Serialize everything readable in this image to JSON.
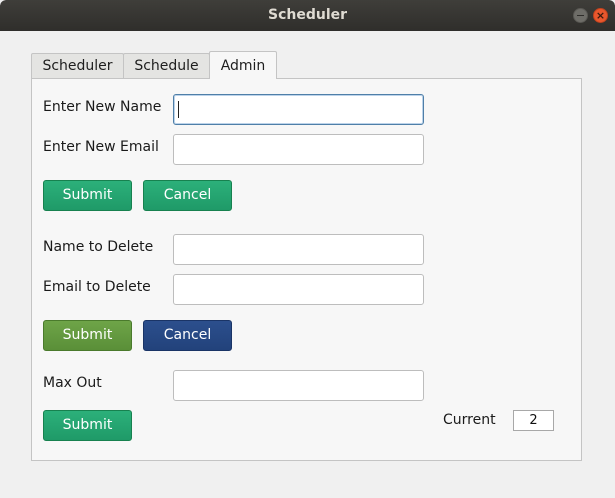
{
  "window": {
    "title": "Scheduler",
    "close_glyph": "×"
  },
  "tabs": [
    {
      "label": "Scheduler",
      "active": false
    },
    {
      "label": "Schedule",
      "active": false
    },
    {
      "label": "Admin",
      "active": true
    }
  ],
  "add_section": {
    "name_label": "Enter New Name",
    "name_value": "",
    "email_label": "Enter New Email",
    "email_value": "",
    "submit_label": "Submit",
    "cancel_label": "Cancel"
  },
  "delete_section": {
    "name_label": "Name to Delete",
    "name_value": "",
    "email_label": "Email to Delete",
    "email_value": "",
    "submit_label": "Submit",
    "cancel_label": "Cancel"
  },
  "max_section": {
    "label": "Max Out",
    "value": "",
    "submit_label": "Submit",
    "current_label": "Current",
    "current_value": "2"
  },
  "colors": {
    "submit_green": "#1f9a68",
    "cancel_green": "#1f9a68",
    "submit_olive": "#5a8f38",
    "cancel_navy": "#22427b",
    "titlebar": "#2f2e2b",
    "close_button": "#e9572d"
  }
}
